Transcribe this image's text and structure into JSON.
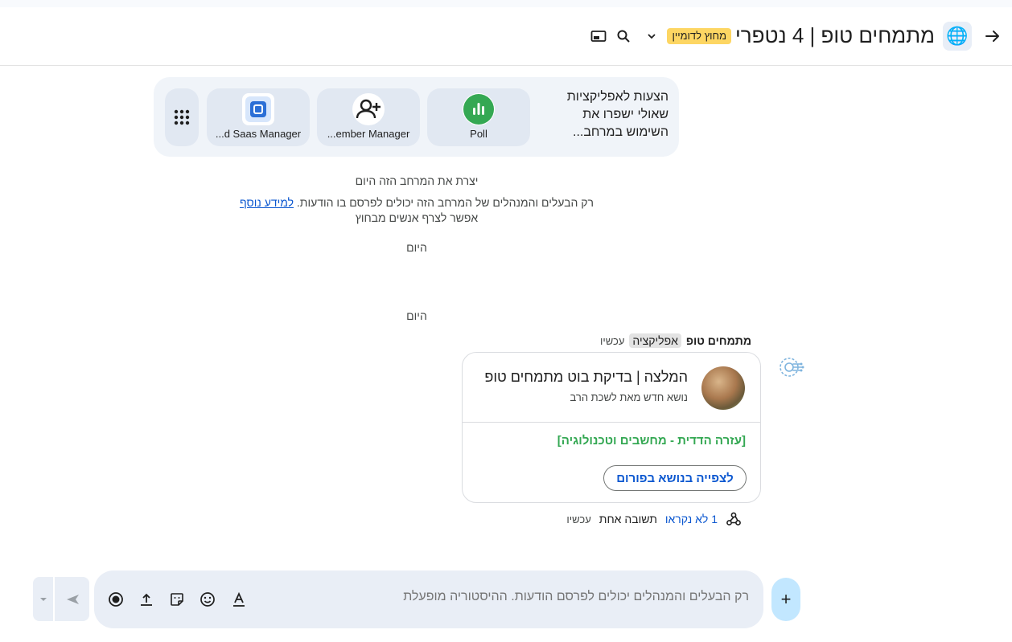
{
  "header": {
    "title": "מתמחים טופ | 4 נטפרי",
    "external_badge": "מחוץ לדומיין",
    "avatar_emoji": "🌐"
  },
  "apps": {
    "suggestion_text": "הצעות לאפליקציות שאולי ישפרו את השימוש במרחב...",
    "items": [
      {
        "label": "Poll",
        "icon": "poll-icon"
      },
      {
        "label": "...ember Manager",
        "icon": "person-add-icon"
      },
      {
        "label": "...d Saas Manager",
        "icon": "saas-manager-icon"
      }
    ]
  },
  "system": {
    "created": "יצרת את המרחב הזה היום",
    "permission": "רק הבעלים והמנהלים של המרחב הזה יכולים לפרסם בו הודעות.",
    "learn_more": "למידע נוסף",
    "external": "אפשר לצרף אנשים מבחוץ",
    "today_1": "היום",
    "today_2": "היום"
  },
  "message": {
    "sender": "מתמחים טופ",
    "tag": "אפליקציה",
    "time": "עכשיו",
    "card": {
      "title": "המלצה | בדיקת בוט מתמחים טופ",
      "subtitle": "נושא חדש מאת לשכת הרב",
      "category": "[עזרה הדדית - מחשבים וטכנולוגיה]",
      "button": "לצפייה בנושא בפורום"
    },
    "thread": {
      "unread": "1 לא נקראו",
      "replies": "תשובה אחת",
      "time": "עכשיו"
    }
  },
  "composer": {
    "placeholder": "רק הבעלים והמנהלים יכולים לפרסם הודעות. ההיסטוריה מופעלת",
    "add_label": "+"
  },
  "colors": {
    "accent": "#0b57d0",
    "badge": "#fdd663",
    "category_green": "#34a853",
    "poll_green": "#34a853"
  }
}
